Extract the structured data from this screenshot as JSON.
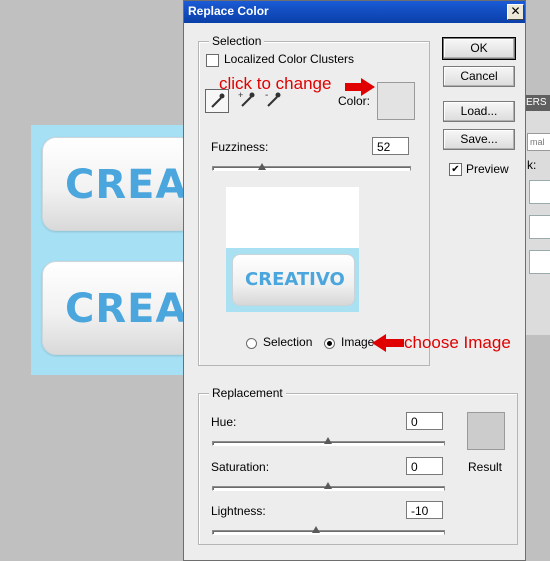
{
  "background": {
    "canvas_button_text": "CREA",
    "side_panel_tab": "ERS",
    "side_panel_field": "mal",
    "side_panel_k": "k:"
  },
  "dialog": {
    "title": "Replace Color",
    "close_glyph": "✕",
    "selection": {
      "legend": "Selection",
      "localized_label": "Localized Color Clusters",
      "localized_checked": false,
      "color_label": "Color:",
      "color_swatch": "#e3e3e3",
      "fuzziness_label": "Fuzziness:",
      "fuzziness_value": "52",
      "fuzziness_slider": 0.26,
      "preview_text": "CREATIVO",
      "radio_selection_label": "Selection",
      "radio_image_label": "Image",
      "selected_mode": "Image"
    },
    "buttons": {
      "ok": "OK",
      "cancel": "Cancel",
      "load": "Load...",
      "save": "Save..."
    },
    "preview": {
      "label": "Preview",
      "checked": true
    },
    "replacement": {
      "legend": "Replacement",
      "hue_label": "Hue:",
      "hue_value": "0",
      "saturation_label": "Saturation:",
      "saturation_value": "0",
      "lightness_label": "Lightness:",
      "lightness_value": "-10",
      "result_label": "Result",
      "result_swatch": "#cccccc"
    }
  },
  "annotations": {
    "click_to_change": "click to change",
    "choose_image": "choose Image",
    "color": "#e00000"
  },
  "icons": [
    "eyedropper-icon",
    "eyedropper-plus-icon",
    "eyedropper-minus-icon",
    "close-icon",
    "checkmark-icon",
    "arrow-right-icon",
    "arrow-left-icon"
  ]
}
